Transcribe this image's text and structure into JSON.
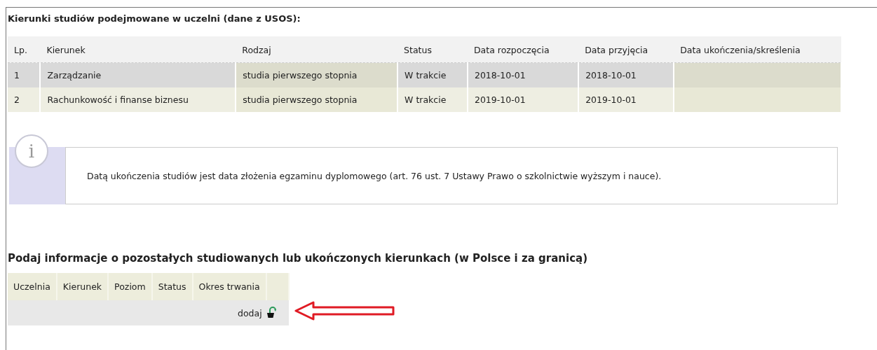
{
  "section_title": "Kierunki studiów podejmowane w uczelni (dane z USOS):",
  "table": {
    "columns": [
      "Lp.",
      "Kierunek",
      "Rodzaj",
      "Status",
      "Data rozpoczęcia",
      "Data przyjęcia",
      "Data ukończenia/skreślenia"
    ],
    "rows": [
      {
        "selected": true,
        "cells": [
          "1",
          "Zarządzanie",
          "studia pierwszego stopnia",
          "W trakcie",
          "2018-10-01",
          "2018-10-01",
          null
        ]
      },
      {
        "selected": false,
        "cells": [
          "2",
          "Rachunkowość i finanse biznesu",
          "studia pierwszego stopnia",
          "W trakcie",
          "2019-10-01",
          "2019-10-01",
          null
        ]
      }
    ]
  },
  "info": {
    "icon": "i",
    "text": "Datą ukończenia studiów jest data złożenia egzaminu dyplomowego (art. 76 ust. 7 Ustawy Prawo o szkolnictwie wyższym i nauce)."
  },
  "other_title": "Podaj informacje o pozostałych studiowanych lub ukończonych kierunkach (w Polsce i za granicą)",
  "other_table": {
    "columns": [
      "Uczelnia",
      "Kierunek",
      "Poziom",
      "Status",
      "Okres trwania"
    ],
    "add_label": "dodaj"
  }
}
